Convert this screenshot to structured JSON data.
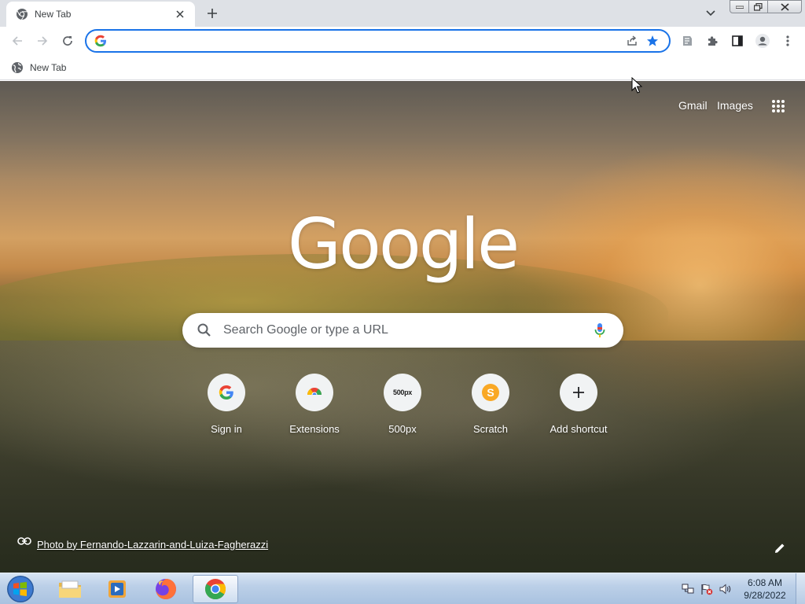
{
  "tab": {
    "title": "New Tab"
  },
  "omnibox": {
    "value": "",
    "placeholder": ""
  },
  "bookmarks": [
    {
      "label": "New Tab"
    }
  ],
  "ntp": {
    "links": {
      "gmail": "Gmail",
      "images": "Images"
    },
    "logo": "Google",
    "search_placeholder": "Search Google or type a URL",
    "shortcuts": [
      {
        "label": "Sign in",
        "icon": "google-g-icon"
      },
      {
        "label": "Extensions",
        "icon": "chrome-webstore-icon"
      },
      {
        "label": "500px",
        "icon": "500px-icon",
        "icon_text": "500px"
      },
      {
        "label": "Scratch",
        "icon": "scratch-icon",
        "icon_text": "S"
      },
      {
        "label": "Add shortcut",
        "icon": "plus-icon"
      }
    ],
    "attribution": "Photo by Fernando-Lazzarin-and-Luiza-Fagherazzi"
  },
  "taskbar": {
    "apps": [
      "explorer",
      "media-player",
      "firefox",
      "chrome"
    ],
    "clock": {
      "time": "6:08 AM",
      "date": "9/28/2022"
    }
  },
  "colors": {
    "accent": "#1a73e8",
    "tabstrip": "#dee1e6",
    "bookmark_star": "#1a73e8"
  }
}
